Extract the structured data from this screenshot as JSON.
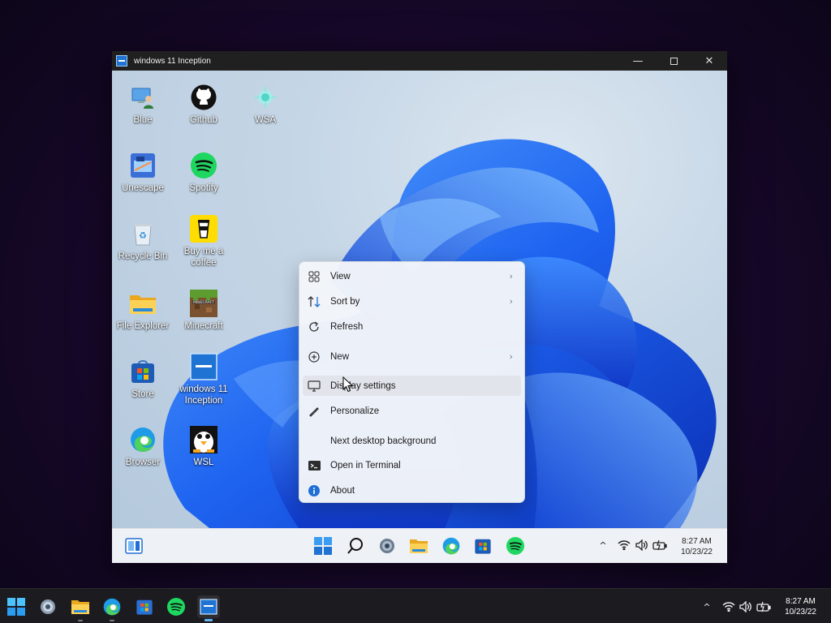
{
  "window": {
    "title": "windows 11 Inception",
    "controls": {
      "minimize": "—",
      "restore": "□",
      "close": "✕"
    }
  },
  "desktop_icons": [
    {
      "label": "Blue",
      "icon": "user-pc-icon"
    },
    {
      "label": "Github",
      "icon": "github-icon"
    },
    {
      "label": "WSA",
      "icon": "android-icon"
    },
    {
      "label": "Unescape",
      "icon": "unescape-icon"
    },
    {
      "label": "Spotify",
      "icon": "spotify-icon"
    },
    {
      "label": "Recycle Bin",
      "icon": "recycle-bin-icon"
    },
    {
      "label": "Buy me a coffee",
      "icon": "coffee-cup-icon"
    },
    {
      "label": "File Explorer",
      "icon": "folder-icon"
    },
    {
      "label": "Minecraft",
      "icon": "minecraft-block-icon"
    },
    {
      "label": "Store",
      "icon": "store-bag-icon"
    },
    {
      "label": "windows 11 Inception",
      "icon": "inception-window-icon"
    },
    {
      "label": "Browser",
      "icon": "edge-icon"
    },
    {
      "label": "WSL",
      "icon": "penguin-icon"
    }
  ],
  "context_menu": {
    "items": [
      {
        "label": "View",
        "icon": "grid-icon",
        "submenu": "›"
      },
      {
        "label": "Sort by",
        "icon": "sort-arrows-icon",
        "submenu": "›"
      },
      {
        "label": "Refresh",
        "icon": "refresh-icon"
      },
      {
        "label": "New",
        "icon": "plus-circle-icon",
        "submenu": "›"
      },
      {
        "label": "Display settings",
        "icon": "monitor-icon",
        "highlighted": true
      },
      {
        "label": "Personalize",
        "icon": "pen-icon"
      },
      {
        "label": "Next desktop background",
        "icon": ""
      },
      {
        "label": "Open in Terminal",
        "icon": "terminal-icon"
      },
      {
        "label": "About",
        "icon": "info-icon"
      }
    ]
  },
  "inner_taskbar": {
    "apps": [
      "widgets-icon",
      "start-icon",
      "search-icon",
      "settings-icon",
      "folder-icon",
      "edge-icon",
      "store-icon",
      "spotify-icon"
    ],
    "tray": {
      "chevron": "^",
      "wifi": "wifi-icon",
      "volume": "volume-icon",
      "battery": "battery-icon"
    },
    "time": "8:27 AM",
    "date": "10/23/22"
  },
  "host_taskbar": {
    "apps": [
      "start-icon",
      "settings-icon",
      "folder-icon",
      "edge-icon",
      "store-icon",
      "spotify-icon",
      "inception-window-icon"
    ],
    "active_app": "inception-window-icon",
    "tray": {
      "chevron": "^",
      "wifi": "wifi-icon",
      "volume": "volume-icon",
      "battery": "battery-icon"
    },
    "time": "8:27 AM",
    "date": "10/23/22"
  },
  "colors": {
    "accent": "#0078d4",
    "spotify": "#1ed760",
    "folder": "#f8c53a",
    "bloom_blue": "#1a5ce8"
  }
}
